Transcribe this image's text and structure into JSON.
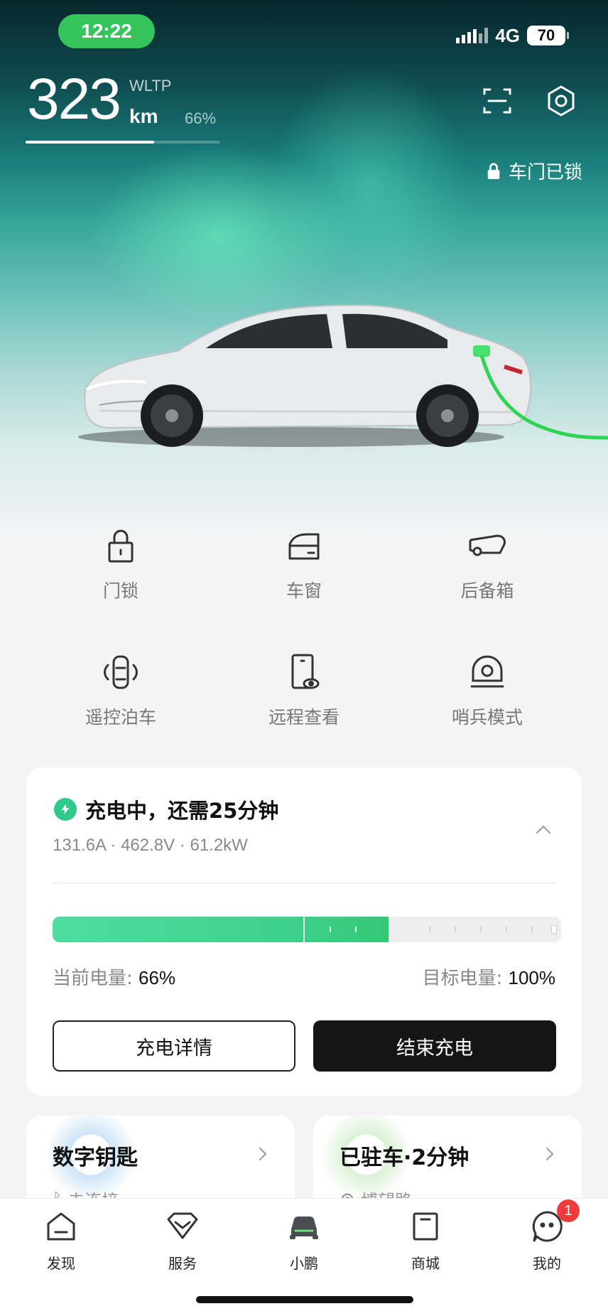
{
  "status_bar": {
    "time": "12:22",
    "network": "4G",
    "battery": "70"
  },
  "range": {
    "value": "323",
    "unit": "km",
    "standard": "WLTP",
    "percent_label": "66%",
    "battery_fraction": 0.66
  },
  "door_status": {
    "label": "车门已锁"
  },
  "controls": [
    {
      "label": "门锁",
      "icon": "padlock-icon"
    },
    {
      "label": "车窗",
      "icon": "car-window-icon"
    },
    {
      "label": "后备箱",
      "icon": "trunk-icon"
    },
    {
      "label": "遥控泊车",
      "icon": "remote-parking-icon"
    },
    {
      "label": "远程查看",
      "icon": "remote-view-icon"
    },
    {
      "label": "哨兵模式",
      "icon": "sentry-camera-icon"
    }
  ],
  "charging": {
    "title": "充电中，还需25分钟",
    "stats": "131.6A · 462.8V · 61.2kW",
    "current_label": "当前电量:",
    "current_value": "66%",
    "target_label": "目标电量:",
    "target_value": "100%",
    "current_fraction": 0.66,
    "detail_button": "充电详情",
    "stop_button": "结束充电",
    "accent_color": "#2fc98a"
  },
  "cards": {
    "digital_key": {
      "title": "数字钥匙",
      "subtitle": "未连接"
    },
    "parking": {
      "title": "已驻车·2分钟",
      "subtitle": "博望路"
    }
  },
  "tabbar": {
    "items": [
      {
        "label": "发现",
        "icon": "discover-icon"
      },
      {
        "label": "服务",
        "icon": "service-icon"
      },
      {
        "label": "小鹏",
        "icon": "car-icon"
      },
      {
        "label": "商城",
        "icon": "mall-icon"
      },
      {
        "label": "我的",
        "icon": "profile-icon"
      }
    ],
    "badge": "1"
  }
}
